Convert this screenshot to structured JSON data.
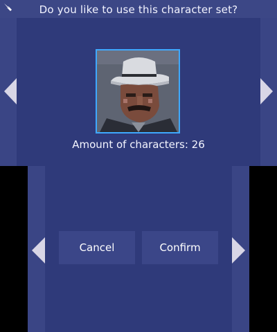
{
  "dialog": {
    "question": "Do you like to use this character set?",
    "count_text": "Amount of characters: 26"
  },
  "icons": {
    "top_left": "back-arrow-icon",
    "nav_prev": "triangle-left-icon",
    "nav_next": "triangle-right-icon"
  },
  "buttons": {
    "cancel": "Cancel",
    "confirm": "Confirm"
  },
  "colors": {
    "panel": "#2f3a7a",
    "panel_light": "#3b4688",
    "selection_border": "#3fa9ff",
    "arrow": "#d8d6e6"
  }
}
